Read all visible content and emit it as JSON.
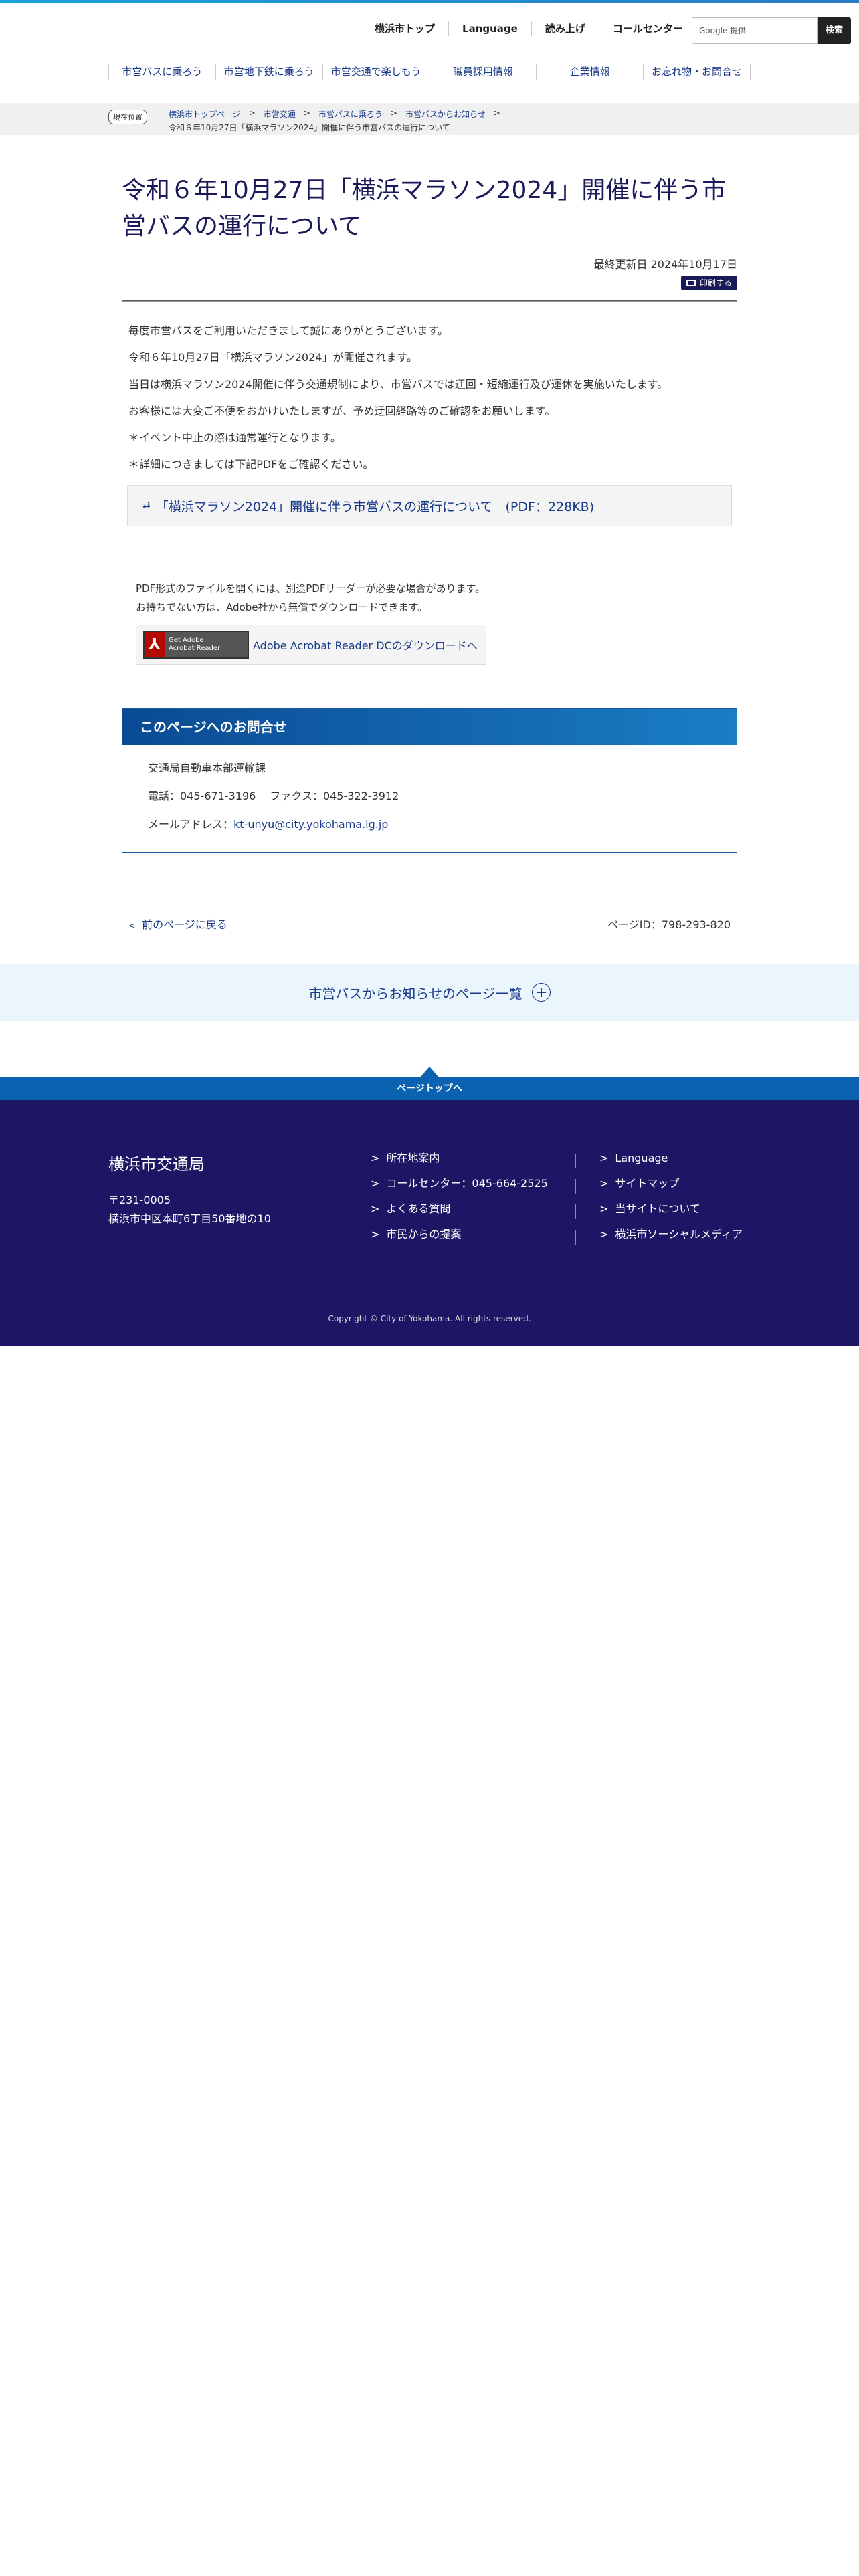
{
  "header": {
    "util_links": [
      "横浜市トップ",
      "Language",
      "読み上げ",
      "コールセンター"
    ],
    "search_placeholder": "Google 提供",
    "search_button": "検索"
  },
  "gnav": [
    "市営バスに乗ろう",
    "市営地下鉄に乗ろう",
    "市営交通で楽しもう",
    "職員採用情報",
    "企業情報",
    "お忘れ物・お問合せ"
  ],
  "breadcrumb": {
    "label": "現在位置",
    "items": [
      "横浜市トップページ",
      "市営交通",
      "市営バスに乗ろう",
      "市営バスからお知らせ"
    ],
    "current": "令和６年10月27日「横浜マラソン2024」開催に伴う市営バスの運行について"
  },
  "main": {
    "title": "令和６年10月27日「横浜マラソン2024」開催に伴う市営バスの運行について",
    "updated": "最終更新日 2024年10月17日",
    "print_label": "印刷する",
    "paragraphs": [
      "毎度市営バスをご利用いただきまして誠にありがとうございます。",
      "令和６年10月27日「横浜マラソン2024」が開催されます。",
      "当日は横浜マラソン2024開催に伴う交通規制により、市営バスでは迂回・短縮運行及び運休を実施いたします。",
      "お客様には大変ご不便をおかけいたしますが、予め迂回経路等のご確認をお願いします。",
      "＊イベント中止の際は通常運行となります。",
      "＊詳細につきましては下記PDFをご確認ください。"
    ],
    "pdf_link": "「横浜マラソン2024」開催に伴う市営バスの運行について　(PDF：228KB)"
  },
  "reader": {
    "line1": "PDF形式のファイルを開くには、別途PDFリーダーが必要な場合があります。",
    "line2": "お持ちでない方は、Adobe社から無償でダウンロードできます。",
    "logo_text1": "Get Adobe",
    "logo_text2": "Acrobat Reader",
    "download_label": "Adobe Acrobat Reader DCのダウンロードへ"
  },
  "contact": {
    "heading": "このページへのお問合せ",
    "dept": "交通局自動車本部運輸課",
    "phone_fax": "電話：045-671-3196　 ファクス：045-322-3912",
    "mail_label": "メールアドレス：",
    "mail": "kt-unyu@city.yokohama.lg.jp"
  },
  "pagefoot": {
    "back": "前のページに戻る",
    "page_id": "ページID：798-293-820"
  },
  "list_bar": "市営バスからお知らせのページ一覧",
  "pagetop": "ページトップへ",
  "footer": {
    "org": "横浜市交通局",
    "zip": "〒231-0005",
    "address": "横浜市中区本町6丁目50番地の10",
    "col1": [
      "所在地案内",
      "コールセンター：045-664-2525",
      "よくある質問",
      "市民からの提案"
    ],
    "col2": [
      "Language",
      "サイトマップ",
      "当サイトについて",
      "横浜市ソーシャルメディア"
    ],
    "copyright": "Copyright © City of Yokohama. All rights reserved."
  }
}
